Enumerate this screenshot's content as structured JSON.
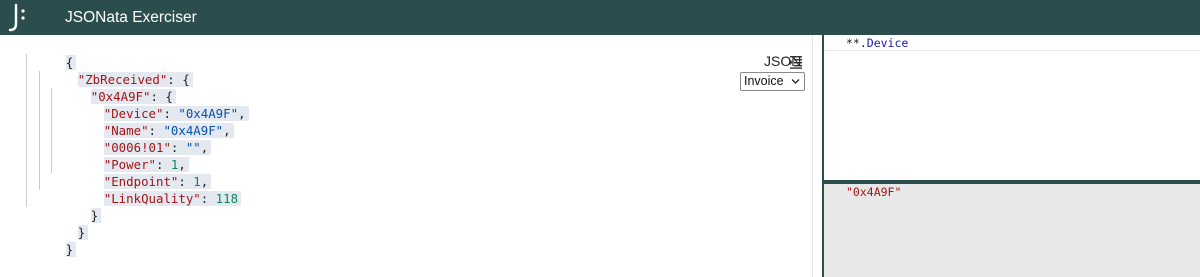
{
  "app": {
    "title": "JSONata Exerciser"
  },
  "input_editor": {
    "lines": [
      [
        "{"
      ],
      [
        "\"ZbReceived\"",
        ": {"
      ],
      [
        "\"0x4A9F\"",
        ": {"
      ],
      [
        "\"Device\"",
        ": ",
        "\"0x4A9F\"",
        ","
      ],
      [
        "\"Name\"",
        ": ",
        "\"0x4A9F\"",
        ","
      ],
      [
        "\"0006!01\"",
        ": ",
        "\"\"",
        ","
      ],
      [
        "\"Power\"",
        ": ",
        "1",
        ","
      ],
      [
        "\"Endpoint\"",
        ": ",
        "1",
        ","
      ],
      [
        "\"LinkQuality\"",
        ": ",
        "118"
      ],
      [
        "}"
      ],
      [
        "}"
      ],
      [
        "}"
      ]
    ]
  },
  "format_controls": {
    "json_label": "JSON",
    "format_icon": "indent-format-icon",
    "sample_select": {
      "selected": "Invoice"
    }
  },
  "expression": {
    "operator": "**.",
    "name": "Device"
  },
  "result": {
    "text": "\"0x4A9F\""
  },
  "colors": {
    "header_bg": "#2b4d4d",
    "key": "#a31515",
    "string": "#0451a5",
    "number": "#098658",
    "result_bg": "#e8e8e8"
  }
}
